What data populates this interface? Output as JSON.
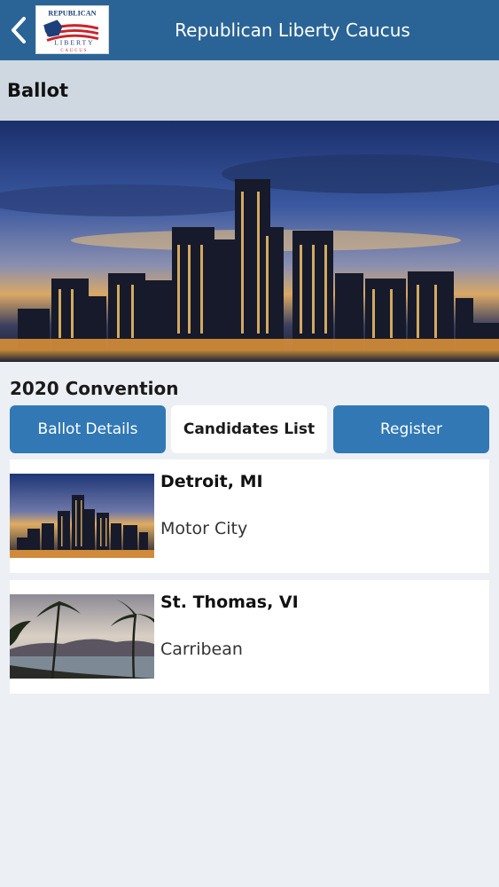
{
  "header": {
    "title": "Republican Liberty Caucus",
    "logo_text": [
      "REPUBLICAN",
      "LIBERTY",
      "CAUCUS"
    ],
    "back_icon": "chevron-left-icon"
  },
  "page": {
    "title": "Ballot"
  },
  "section": {
    "title": "2020 Convention"
  },
  "tabs": [
    {
      "label": "Ballot Details",
      "selected": false
    },
    {
      "label": "Candidates List",
      "selected": true
    },
    {
      "label": "Register",
      "selected": false
    }
  ],
  "locations": [
    {
      "name": "Detroit, MI",
      "subtitle": "Motor City"
    },
    {
      "name": "St. Thomas, VI",
      "subtitle": "Carribean"
    }
  ],
  "colors": {
    "header_bg": "#2a6496",
    "subheader_bg": "#cfd8e0",
    "tab_blue": "#3178b5",
    "page_bg": "#eceff4"
  }
}
